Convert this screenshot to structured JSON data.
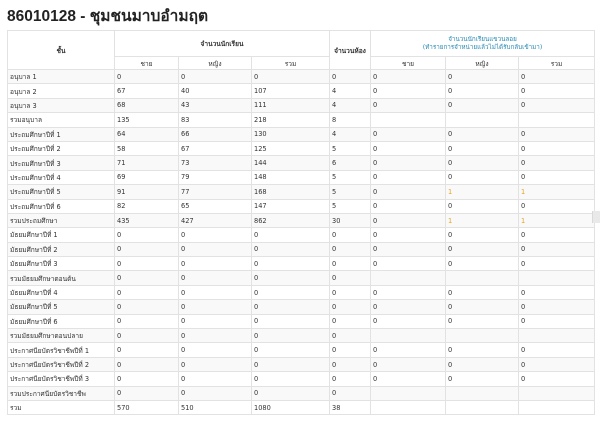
{
  "page": {
    "title": "86010128 - ชุมชนมาบอำมฤต"
  },
  "table": {
    "headers": {
      "level": "ชั้น",
      "students": "จำนวนนักเรียน",
      "rooms": "จำนวนห้อง",
      "dropouts_line1": "จำนวนนักเรียนแขวนลอย",
      "dropouts_line2": "(ทำรายการจำหน่ายแล้วไม่ได้รับกลับเข้ามา)",
      "male": "ชาย",
      "female": "หญิง",
      "total": "รวม",
      "drop_male": "ชาย",
      "drop_female": "หญิง",
      "drop_total": "รวม"
    },
    "rows": [
      {
        "level": "อนุบาล 1",
        "male": "0",
        "female": "0",
        "total": "0",
        "rooms": "0",
        "drop_male": "0",
        "drop_female": "0",
        "drop_total": "0"
      },
      {
        "level": "อนุบาล 2",
        "male": "67",
        "female": "40",
        "total": "107",
        "rooms": "4",
        "drop_male": "0",
        "drop_female": "0",
        "drop_total": "0"
      },
      {
        "level": "อนุบาล 3",
        "male": "68",
        "female": "43",
        "total": "111",
        "rooms": "4",
        "drop_male": "0",
        "drop_female": "0",
        "drop_total": "0"
      },
      {
        "level": "รวมอนุบาล",
        "male": "135",
        "female": "83",
        "total": "218",
        "rooms": "8",
        "drop_male": "",
        "drop_female": "",
        "drop_total": ""
      },
      {
        "level": "ประถมศึกษาปีที่ 1",
        "male": "64",
        "female": "66",
        "total": "130",
        "rooms": "4",
        "drop_male": "0",
        "drop_female": "0",
        "drop_total": "0"
      },
      {
        "level": "ประถมศึกษาปีที่ 2",
        "male": "58",
        "female": "67",
        "total": "125",
        "rooms": "5",
        "drop_male": "0",
        "drop_female": "0",
        "drop_total": "0"
      },
      {
        "level": "ประถมศึกษาปีที่ 3",
        "male": "71",
        "female": "73",
        "total": "144",
        "rooms": "6",
        "drop_male": "0",
        "drop_female": "0",
        "drop_total": "0"
      },
      {
        "level": "ประถมศึกษาปีที่ 4",
        "male": "69",
        "female": "79",
        "total": "148",
        "rooms": "5",
        "drop_male": "0",
        "drop_female": "0",
        "drop_total": "0"
      },
      {
        "level": "ประถมศึกษาปีที่ 5",
        "male": "91",
        "female": "77",
        "total": "168",
        "rooms": "5",
        "drop_male": "0",
        "drop_female": "1",
        "drop_total": "1",
        "highlight": true
      },
      {
        "level": "ประถมศึกษาปีที่ 6",
        "male": "82",
        "female": "65",
        "total": "147",
        "rooms": "5",
        "drop_male": "0",
        "drop_female": "0",
        "drop_total": "0"
      },
      {
        "level": "รวมประถมศึกษา",
        "male": "435",
        "female": "427",
        "total": "862",
        "rooms": "30",
        "drop_male": "0",
        "drop_female": "1",
        "drop_total": "1",
        "highlight": true
      },
      {
        "level": "มัธยมศึกษาปีที่ 1",
        "male": "0",
        "female": "0",
        "total": "0",
        "rooms": "0",
        "drop_male": "0",
        "drop_female": "0",
        "drop_total": "0"
      },
      {
        "level": "มัธยมศึกษาปีที่ 2",
        "male": "0",
        "female": "0",
        "total": "0",
        "rooms": "0",
        "drop_male": "0",
        "drop_female": "0",
        "drop_total": "0"
      },
      {
        "level": "มัธยมศึกษาปีที่ 3",
        "male": "0",
        "female": "0",
        "total": "0",
        "rooms": "0",
        "drop_male": "0",
        "drop_female": "0",
        "drop_total": "0"
      },
      {
        "level": "รวมมัธยมศึกษาตอนต้น",
        "male": "0",
        "female": "0",
        "total": "0",
        "rooms": "0",
        "drop_male": "",
        "drop_female": "",
        "drop_total": ""
      },
      {
        "level": "มัธยมศึกษาปีที่ 4",
        "male": "0",
        "female": "0",
        "total": "0",
        "rooms": "0",
        "drop_male": "0",
        "drop_female": "0",
        "drop_total": "0"
      },
      {
        "level": "มัธยมศึกษาปีที่ 5",
        "male": "0",
        "female": "0",
        "total": "0",
        "rooms": "0",
        "drop_male": "0",
        "drop_female": "0",
        "drop_total": "0"
      },
      {
        "level": "มัธยมศึกษาปีที่ 6",
        "male": "0",
        "female": "0",
        "total": "0",
        "rooms": "0",
        "drop_male": "0",
        "drop_female": "0",
        "drop_total": "0"
      },
      {
        "level": "รวมมัธยมศึกษาตอนปลาย",
        "male": "0",
        "female": "0",
        "total": "0",
        "rooms": "0",
        "drop_male": "",
        "drop_female": "",
        "drop_total": ""
      },
      {
        "level": "ประกาศนียบัตรวิชาชีพปีที่ 1",
        "male": "0",
        "female": "0",
        "total": "0",
        "rooms": "0",
        "drop_male": "0",
        "drop_female": "0",
        "drop_total": "0"
      },
      {
        "level": "ประกาศนียบัตรวิชาชีพปีที่ 2",
        "male": "0",
        "female": "0",
        "total": "0",
        "rooms": "0",
        "drop_male": "0",
        "drop_female": "0",
        "drop_total": "0"
      },
      {
        "level": "ประกาศนียบัตรวิชาชีพปีที่ 3",
        "male": "0",
        "female": "0",
        "total": "0",
        "rooms": "0",
        "drop_male": "0",
        "drop_female": "0",
        "drop_total": "0"
      },
      {
        "level": "รวมประกาศนียบัตรวิชาชีพ",
        "male": "0",
        "female": "0",
        "total": "0",
        "rooms": "0",
        "drop_male": "",
        "drop_female": "",
        "drop_total": ""
      },
      {
        "level": "รวม",
        "male": "570",
        "female": "510",
        "total": "1080",
        "rooms": "38",
        "drop_male": "",
        "drop_female": "",
        "drop_total": ""
      }
    ]
  },
  "colors": {
    "link": "#2a8bb4",
    "highlight": "#e5a51f",
    "border": "#e2e2e2",
    "stripe": "#f9f9f9"
  }
}
